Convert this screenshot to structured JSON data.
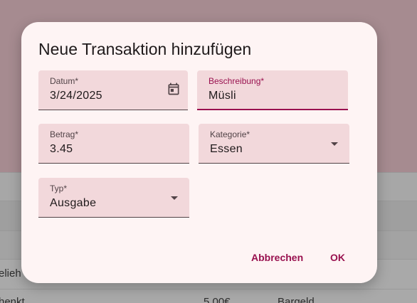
{
  "background": {
    "rows": [
      {
        "col1": "elieh",
        "col2": "",
        "col3": ""
      },
      {
        "col1": "henkt",
        "col2": "5,00€",
        "col3": "Bargeld"
      }
    ]
  },
  "dialog": {
    "title": "Neue Transaktion hinzufügen",
    "fields": {
      "datum": {
        "label": "Datum*",
        "value": "3/24/2025",
        "icon": "calendar-icon"
      },
      "beschreibung": {
        "label": "Beschreibung*",
        "value": "Müsli"
      },
      "betrag": {
        "label": "Betrag*",
        "value": "3.45"
      },
      "kategorie": {
        "label": "Kategorie*",
        "value": "Essen"
      },
      "typ": {
        "label": "Typ*",
        "value": "Ausgabe"
      }
    },
    "actions": {
      "cancel_label": "Abbrechen",
      "ok_label": "OK"
    }
  },
  "colors": {
    "accent": "#99114f",
    "dialog_bg": "#fef4f4",
    "field_bg": "#f2d8db",
    "scrim_bg": "#a68b90"
  }
}
